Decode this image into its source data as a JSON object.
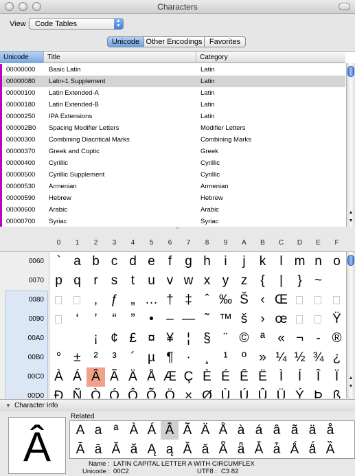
{
  "window": {
    "title": "Characters"
  },
  "view": {
    "label": "View :",
    "selected": "Code Tables",
    "arrows": "▲\n▼"
  },
  "tabs": [
    {
      "label": "Unicode",
      "active": true
    },
    {
      "label": "Other Encodings",
      "active": false
    },
    {
      "label": "Favorites",
      "active": false
    }
  ],
  "table": {
    "headers": {
      "unicode": "Unicode",
      "title": "Title",
      "category": "Category"
    },
    "rows": [
      {
        "code": "00000000",
        "title": "Basic Latin",
        "category": "Latin"
      },
      {
        "code": "00000080",
        "title": "Latin-1 Supplement",
        "category": "Latin",
        "selected": true
      },
      {
        "code": "00000100",
        "title": "Latin Extended-A",
        "category": "Latin"
      },
      {
        "code": "00000180",
        "title": "Latin Extended-B",
        "category": "Latin"
      },
      {
        "code": "00000250",
        "title": "IPA Extensions",
        "category": "Latin"
      },
      {
        "code": "000002B0",
        "title": "Spacing Modifier Letters",
        "category": "Modifier Letters"
      },
      {
        "code": "00000300",
        "title": "Combining Diacritical Marks",
        "category": "Combining Marks"
      },
      {
        "code": "00000370",
        "title": "Greek and Coptic",
        "category": "Greek"
      },
      {
        "code": "00000400",
        "title": "Cyrillic",
        "category": "Cyrillic"
      },
      {
        "code": "00000500",
        "title": "Cyrillic Supplement",
        "category": "Cyrillic"
      },
      {
        "code": "00000530",
        "title": "Armenian",
        "category": "Armenian"
      },
      {
        "code": "00000590",
        "title": "Hebrew",
        "category": "Hebrew"
      },
      {
        "code": "00000600",
        "title": "Arabic",
        "category": "Arabic"
      },
      {
        "code": "00000700",
        "title": "Syriac",
        "category": "Syriac"
      }
    ]
  },
  "grid": {
    "columns": [
      "0",
      "1",
      "2",
      "3",
      "4",
      "5",
      "6",
      "7",
      "8",
      "9",
      "A",
      "B",
      "C",
      "D",
      "E",
      "F"
    ],
    "rows": [
      {
        "label": "0060",
        "chars": [
          "`",
          "a",
          "b",
          "c",
          "d",
          "e",
          "f",
          "g",
          "h",
          "i",
          "j",
          "k",
          "l",
          "m",
          "n",
          "o"
        ]
      },
      {
        "label": "0070",
        "chars": [
          "p",
          "q",
          "r",
          "s",
          "t",
          "u",
          "v",
          "w",
          "x",
          "y",
          "z",
          "{",
          "|",
          "}",
          "~",
          ""
        ]
      },
      {
        "label": "0080",
        "chars": [
          "",
          "",
          "‚",
          "ƒ",
          "„",
          "…",
          "†",
          "‡",
          "ˆ",
          "‰",
          "Š",
          "‹",
          "Œ",
          "",
          "",
          ""
        ]
      },
      {
        "label": "0090",
        "chars": [
          "",
          "‘",
          "’",
          "“",
          "”",
          "•",
          "–",
          "—",
          "˜",
          "™",
          "š",
          "›",
          "œ",
          "",
          "",
          "Ÿ"
        ]
      },
      {
        "label": "00A0",
        "chars": [
          "",
          " ",
          "¡",
          "¢",
          "£",
          "¤",
          "¥",
          "¦",
          "§",
          "¨",
          "©",
          "ª",
          "«",
          "¬",
          "-",
          "®",
          "¯"
        ]
      },
      {
        "label": "00B0",
        "chars": [
          "°",
          "±",
          "²",
          "³",
          "´",
          "µ",
          "¶",
          "·",
          "¸",
          "¹",
          "º",
          "»",
          "¼",
          "½",
          "¾",
          "¿"
        ]
      },
      {
        "label": "00C0",
        "chars": [
          "À",
          "Á",
          "Â",
          "Ã",
          "Ä",
          "Å",
          "Æ",
          "Ç",
          "È",
          "É",
          "Ê",
          "Ë",
          "Ì",
          "Í",
          "Î",
          "Ï"
        ]
      },
      {
        "label": "00D0",
        "chars": [
          "Ð",
          "Ñ",
          "Ò",
          "Ó",
          "Ô",
          "Õ",
          "Ö",
          "×",
          "Ø",
          "Ù",
          "Ú",
          "Û",
          "Ü",
          "Ý",
          "Þ",
          "ß"
        ]
      }
    ],
    "highlighted": "Â"
  },
  "character_info": {
    "title": "Character Info",
    "glyph": "Â",
    "related_label": "Related",
    "related": [
      [
        "A",
        "a",
        "ª",
        "À",
        "Á",
        "Â",
        "Ã",
        "Ä",
        "Å",
        "à",
        "á",
        "â",
        "ã",
        "ä",
        "å"
      ],
      [
        "Ā",
        "ā",
        "Ă",
        "ă",
        "Ą",
        "ą",
        "Ǎ",
        "ǎ",
        "Ǟ",
        "ǟ",
        "Ǡ",
        "ǡ",
        "Ǻ",
        "ǻ",
        "Ȁ"
      ]
    ],
    "name_label": "Name :",
    "name": "LATIN CAPITAL LETTER A WITH CIRCUMFLEX",
    "unicode_label": "Unicode :",
    "unicode": "00C2",
    "utf8_label": "UTF8 :",
    "utf8": "C3 82"
  },
  "colors": {
    "selection_blue": "#6ea0e3",
    "highlight": "#f1a189",
    "block_marker": "#c000c0"
  }
}
